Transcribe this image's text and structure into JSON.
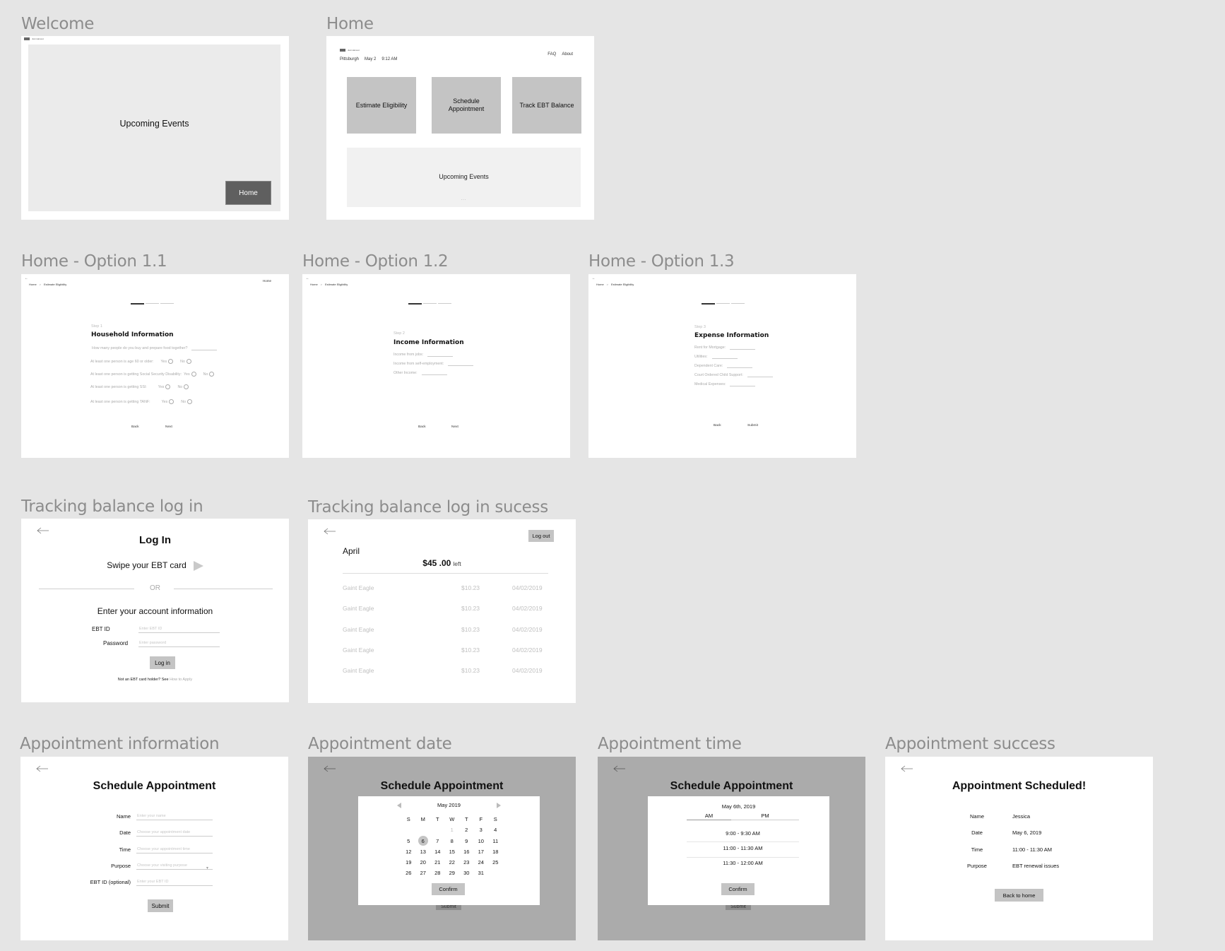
{
  "frames": {
    "welcome": {
      "label": "Welcome",
      "logo_text": "Just Harvest",
      "panel_title": "Upcoming Events",
      "home_button": "Home"
    },
    "home": {
      "label": "Home",
      "logo_text": "Just Harvest",
      "location": "Pittsburgh",
      "date": "May 2",
      "time": "9:12 AM",
      "nav": [
        "FAQ",
        "About"
      ],
      "tiles": [
        "Estimate Eligibility",
        "Schedule Appointment",
        "Track EBT Balance"
      ],
      "events_title": "Upcoming Events",
      "events_more": "..."
    },
    "option_1_1": {
      "label": "Home - Option 1.1",
      "back_arrow": "←",
      "breadcrumb": [
        "Home",
        "Estimate Eligibility"
      ],
      "breadcrumb_sep": ">",
      "top_link": "Home",
      "progress_step": 1,
      "progress_total": 3,
      "step": "Step 1",
      "title": "Household Information",
      "question": "How many people do you buy and prepare food together?",
      "radio_questions": [
        "At least one person is age 60 or older:",
        "At least one person is getting Social Security Disability:",
        "At least one person is getting SSI:",
        "At least one person is getting TANF:"
      ],
      "yes": "Yes",
      "no": "No",
      "back": "Back",
      "next": "Next"
    },
    "option_1_2": {
      "label": "Home - Option 1.2",
      "back_arrow": "←",
      "breadcrumb": [
        "Home",
        "Estimate Eligibility"
      ],
      "breadcrumb_sep": ">",
      "progress_step": 1,
      "progress_total": 3,
      "step": "Step 2",
      "title": "Income Information",
      "fields": [
        "Income from jobs:",
        "Income from self-employment:",
        "Other Income:"
      ],
      "back": "Back",
      "next": "Next"
    },
    "option_1_3": {
      "label": "Home - Option 1.3",
      "back_arrow": "←",
      "breadcrumb": [
        "Home",
        "Estimate Eligibility"
      ],
      "breadcrumb_sep": ">",
      "progress_step": 1,
      "progress_total": 3,
      "step": "Step 3",
      "title": "Expense Information",
      "fields": [
        "Rent for Mortgage:",
        "Utilities:",
        "Dependent Care:",
        "Court Ordered Child Support:",
        "Medical Expenses:"
      ],
      "back": "Back",
      "submit": "Submit"
    },
    "login": {
      "label": "Tracking balance log in",
      "title": "Log In",
      "swipe": "Swipe your EBT card",
      "or": "OR",
      "enter_info": "Enter your account information",
      "ebt_label": "EBT ID",
      "ebt_placeholder": "Enter EBT ID",
      "password_label": "Password",
      "password_placeholder": "Enter password",
      "login_button": "Log in",
      "note": "Not an EBT card holder? See",
      "apply_link": "How to Apply"
    },
    "balance": {
      "label": "Tracking balance log in sucess",
      "logout": "Log out",
      "month": "April",
      "amount": "$45 .00",
      "amount_suffix": "left",
      "transactions": [
        {
          "store": "Gaint Eagle",
          "amount": "$10.23",
          "date": "04/02/2019"
        },
        {
          "store": "Gaint Eagle",
          "amount": "$10.23",
          "date": "04/02/2019"
        },
        {
          "store": "Gaint Eagle",
          "amount": "$10.23",
          "date": "04/02/2019"
        },
        {
          "store": "Gaint Eagle",
          "amount": "$10.23",
          "date": "04/02/2019"
        },
        {
          "store": "Gaint Eagle",
          "amount": "$10.23",
          "date": "04/02/2019"
        }
      ]
    },
    "appt_info": {
      "label": "Appointment information",
      "title": "Schedule Appointment",
      "fields": [
        {
          "label": "Name",
          "placeholder": "Enter your name"
        },
        {
          "label": "Date",
          "placeholder": "Choose your appointment date"
        },
        {
          "label": "Time",
          "placeholder": "Choose your appointment time"
        },
        {
          "label": "Purpose",
          "placeholder": "Choose your visiting purpose"
        },
        {
          "label": "EBT ID (optional)",
          "placeholder": "Enter your EBT ID"
        }
      ],
      "submit": "Submit"
    },
    "appt_date": {
      "label": "Appointment date",
      "title": "Schedule Appointment",
      "month": "May 2019",
      "weekdays": [
        "S",
        "M",
        "T",
        "W",
        "T",
        "F",
        "S"
      ],
      "first_weekday_index": 3,
      "days_in_month": 31,
      "disabled_days": [
        1
      ],
      "selected_day": 6,
      "confirm": "Confirm",
      "submit_behind": "Submit"
    },
    "appt_time": {
      "label": "Appointment time",
      "title": "Schedule Appointment",
      "date": "May 6th, 2019",
      "tabs": [
        "AM",
        "PM"
      ],
      "active_tab": "AM",
      "slots": [
        "9:00 - 9:30 AM",
        "11:00 - 11:30 AM",
        "11:30 - 12:00 AM"
      ],
      "confirm": "Confirm",
      "submit_behind": "Submit"
    },
    "appt_success": {
      "label": "Appointment success",
      "title": "Appointment Scheduled!",
      "rows": [
        {
          "label": "Name",
          "value": "Jessica"
        },
        {
          "label": "Date",
          "value": "May 6, 2019"
        },
        {
          "label": "Time",
          "value": "11:00 - 11:30 AM"
        },
        {
          "label": "Purpose",
          "value": "EBT renewal issues"
        }
      ],
      "back_home": "Back to home"
    }
  }
}
